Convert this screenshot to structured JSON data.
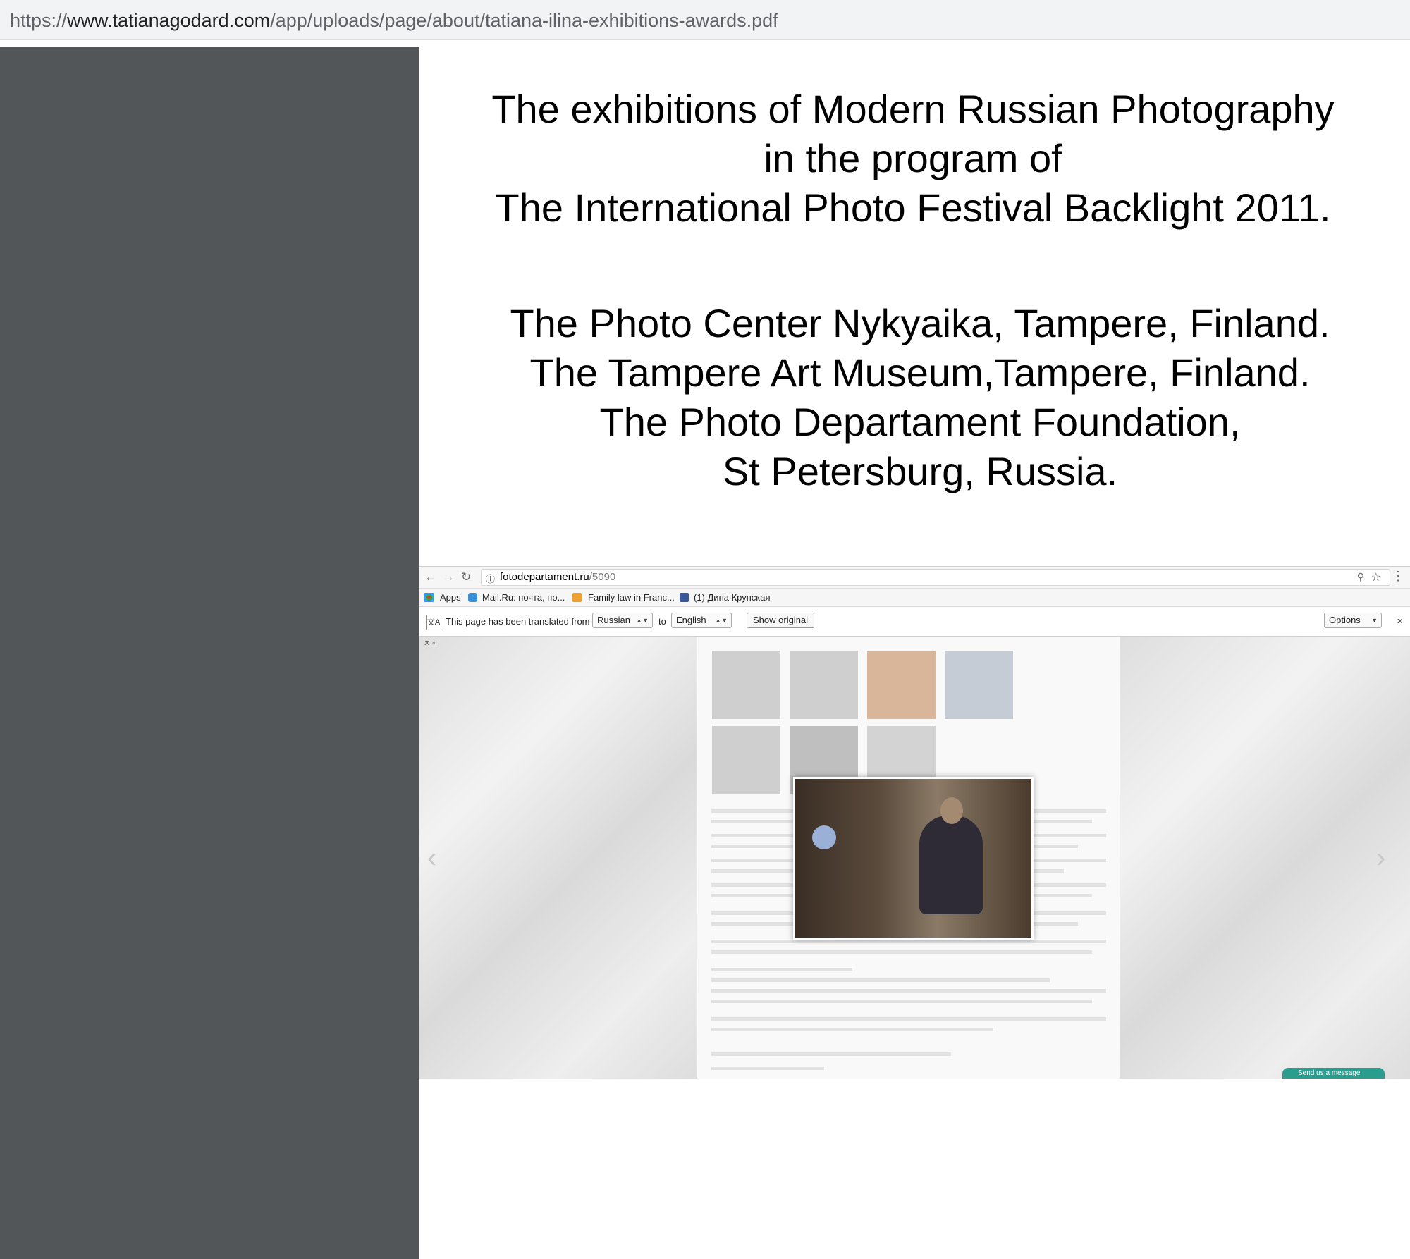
{
  "address_bar": {
    "scheme": "https://",
    "host": "www.tatianagodard.com",
    "path": "/app/uploads/page/about/tatiana-ilina-exhibitions-awards.pdf"
  },
  "document": {
    "title_lines": [
      "The exhibitions of Modern Russian Photography",
      "in the program of",
      "The International Photo Festival Backlight 2011."
    ],
    "venue_lines": [
      "The Photo Center Nykyaika, Tampere, Finland.",
      "The Tampere Art Museum,Tampere, Finland.",
      "The Photo Departament Foundation,",
      "St Petersburg, Russia."
    ]
  },
  "embedded_screenshot": {
    "url_host": "fotodepartament.ru",
    "url_path": "/5090",
    "bookmarks": [
      "Apps",
      "Mail.Ru: почта, по...",
      "Family law in Franc...",
      "(1) Дина Крупская"
    ],
    "translate_bar": {
      "message": "This page has been translated from",
      "from_language": "Russian",
      "to_word": "to",
      "to_language": "English",
      "show_original": "Show original",
      "options": "Options",
      "close": "×"
    },
    "send_message": "Send us a message"
  },
  "colors": {
    "sidebar": "#525659",
    "address_bar": "#f1f3f4"
  }
}
